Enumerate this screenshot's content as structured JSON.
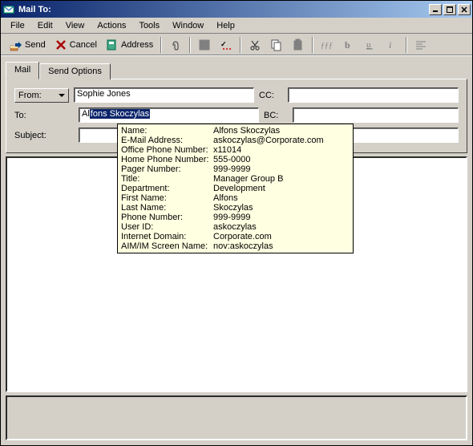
{
  "window": {
    "title": "Mail To:"
  },
  "menu": {
    "file": "File",
    "edit": "Edit",
    "view": "View",
    "actions": "Actions",
    "tools": "Tools",
    "window": "Window",
    "help": "Help"
  },
  "toolbar": {
    "send": "Send",
    "cancel": "Cancel",
    "address": "Address"
  },
  "tabs": {
    "mail": "Mail",
    "send_options": "Send Options"
  },
  "form": {
    "from_label": "From:",
    "from_value": "Sophie Jones",
    "to_label": "To:",
    "to_prefix": "Al",
    "to_highlight": "fons Skoczylas",
    "subject_label": "Subject:",
    "subject_value": "",
    "cc_label": "CC:",
    "cc_value": "",
    "bc_label": "BC:",
    "bc_value": ""
  },
  "tooltip": {
    "rows": [
      {
        "k": "Name:",
        "v": "Alfons Skoczylas"
      },
      {
        "k": "E-Mail Address:",
        "v": "askoczylas@Corporate.com"
      },
      {
        "k": "Office Phone Number:",
        "v": "x11014"
      },
      {
        "k": "Home Phone Number:",
        "v": "555-0000"
      },
      {
        "k": "Pager Number:",
        "v": "999-9999"
      },
      {
        "k": "Title:",
        "v": "Manager Group B"
      },
      {
        "k": "Department:",
        "v": "Development"
      },
      {
        "k": "First Name:",
        "v": "Alfons"
      },
      {
        "k": "Last Name:",
        "v": "Skoczylas"
      },
      {
        "k": "Phone Number:",
        "v": "999-9999"
      },
      {
        "k": "User ID:",
        "v": "askoczylas"
      },
      {
        "k": "Internet Domain:",
        "v": "Corporate.com"
      },
      {
        "k": "AIM/IM Screen Name:",
        "v": "nov:askoczylas"
      }
    ]
  }
}
